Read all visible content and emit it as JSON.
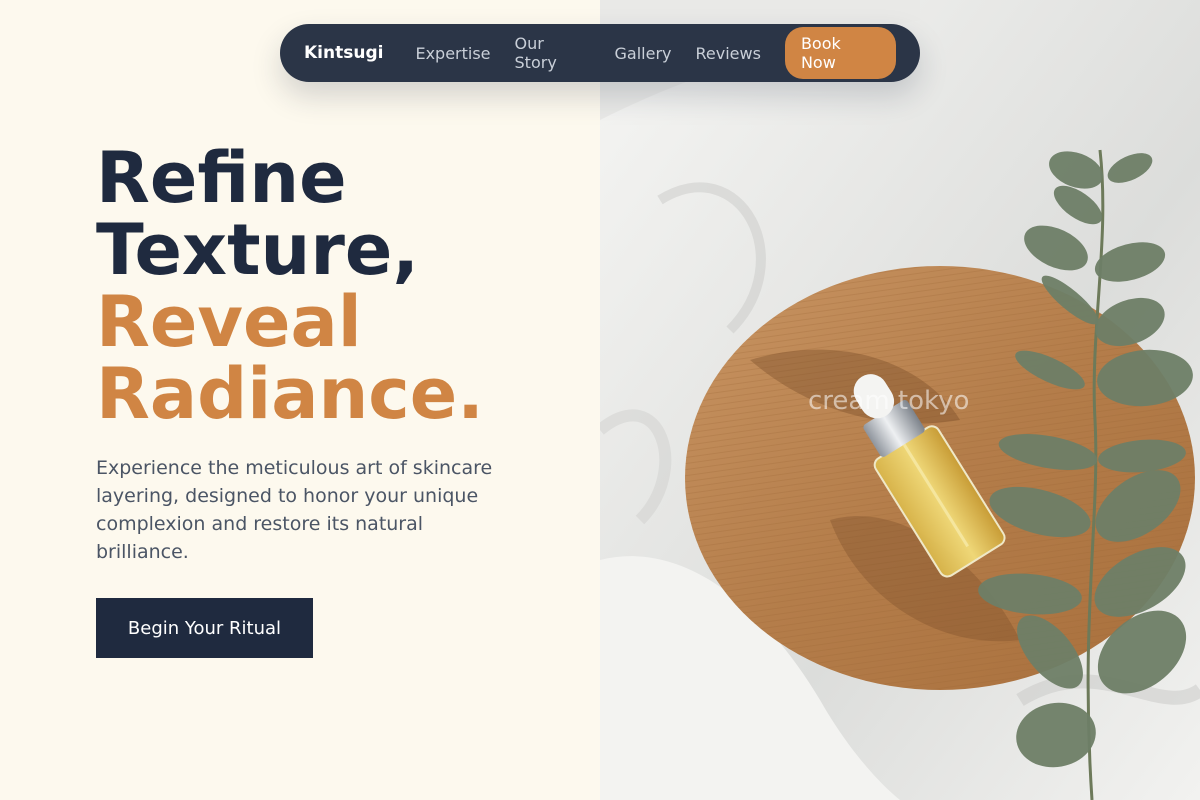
{
  "nav": {
    "brand": "Kintsugi",
    "links": [
      "Expertise",
      "Our Story",
      "Gallery",
      "Reviews"
    ],
    "cta": "Book Now"
  },
  "hero": {
    "headline_line1": "Refine",
    "headline_line2": "Texture,",
    "headline_line3": "Reveal",
    "headline_line4": "Radiance.",
    "subtext": "Experience the meticulous art of skincare layering, designed to honor your unique complexion and restore its natural brilliance.",
    "cta": "Begin Your Ritual"
  },
  "image": {
    "watermark": "cream tokyo"
  },
  "colors": {
    "navy": "#1f2a3f",
    "accent": "#d08544",
    "background": "#fdf9ee"
  }
}
